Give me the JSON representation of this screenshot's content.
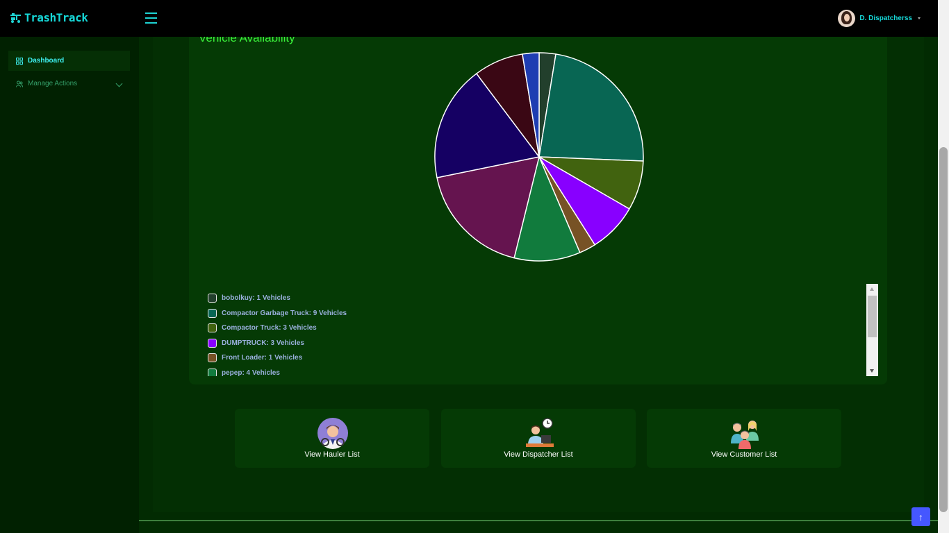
{
  "app": {
    "name": "TrashTrack"
  },
  "header": {
    "user_name": "D. Dispatcherss"
  },
  "sidebar": {
    "items": [
      {
        "label": "Dashboard",
        "icon": "dashboard-grid-icon",
        "active": true
      },
      {
        "label": "Manage Actions",
        "icon": "users-icon",
        "active": false
      }
    ]
  },
  "chart_title": "Vehicle Availability",
  "chart_data": {
    "type": "pie",
    "title": "Vehicle Availability",
    "unit": "Vehicles",
    "slices": [
      {
        "label": "bobolkuy",
        "value": 1,
        "color": "#223f2c"
      },
      {
        "label": "Compactor Garbage Truck",
        "value": 9,
        "color": "#086653"
      },
      {
        "label": "Compactor Truck",
        "value": 3,
        "color": "#41630f"
      },
      {
        "label": "DUMPTRUCK",
        "value": 3,
        "color": "#8800ff"
      },
      {
        "label": "Front Loader",
        "value": 1,
        "color": "#775225"
      },
      {
        "label": "pepep",
        "value": 4,
        "color": "#117b3d"
      },
      {
        "label": "",
        "value": 7,
        "color": "#65144f"
      },
      {
        "label": "",
        "value": 7,
        "color": "#150063"
      },
      {
        "label": "",
        "value": 3,
        "color": "#3a0714"
      },
      {
        "label": "",
        "value": 1,
        "color": "#1e3db2"
      }
    ]
  },
  "legend": [
    {
      "text": "bobolkuy: 1 Vehicles",
      "color": "#223f2c"
    },
    {
      "text": "Compactor Garbage Truck: 9 Vehicles",
      "color": "#086653"
    },
    {
      "text": "Compactor Truck: 3 Vehicles",
      "color": "#41630f"
    },
    {
      "text": "DUMPTRUCK: 3 Vehicles",
      "color": "#8800ff"
    },
    {
      "text": "Front Loader: 1 Vehicles",
      "color": "#775225"
    },
    {
      "text": "pepep: 4 Vehicles",
      "color": "#117b3d"
    }
  ],
  "cards": [
    {
      "label": "View Hauler List",
      "icon": "hauler-driver-icon"
    },
    {
      "label": "View Dispatcher List",
      "icon": "dispatcher-desk-icon"
    },
    {
      "label": "View Customer List",
      "icon": "customer-group-icon"
    }
  ],
  "colors": {
    "accent": "#16d9d9",
    "title_green": "#3af03a",
    "back_to_top": "#4557ff"
  }
}
